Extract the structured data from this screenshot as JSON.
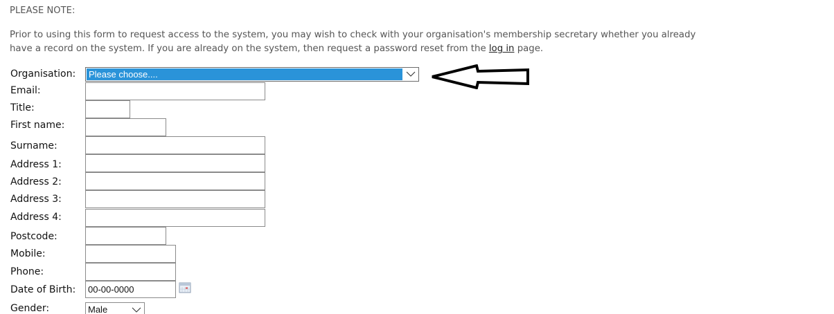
{
  "notice": {
    "title": "PLEASE NOTE:",
    "line1": "Prior to using this form to request access to the system, you may wish to check with your organisation's membership secretary whether you already",
    "line2_before": "have a record on the system. If you are already on the system, then request a password reset from the ",
    "login_link": "log in",
    "line2_after": " page."
  },
  "form": {
    "labels": {
      "organisation": "Organisation:",
      "email": "Email:",
      "title": "Title:",
      "first_name": "First name:",
      "surname": "Surname:",
      "address1": "Address 1:",
      "address2": "Address 2:",
      "address3": "Address 3:",
      "address4": "Address 4:",
      "postcode": "Postcode:",
      "mobile": "Mobile:",
      "phone": "Phone:",
      "dob": "Date of Birth:",
      "gender": "Gender:"
    },
    "organisation_selected": "Please choose....",
    "dob_value": "00-00-0000",
    "gender_selected": "Male"
  },
  "icons": {
    "dropdown": "chevron-down-icon",
    "calendar": "calendar-icon",
    "annotation": "left-arrow-icon"
  },
  "colors": {
    "selection_highlight": "#2a93d9",
    "notice_text": "#555555"
  }
}
